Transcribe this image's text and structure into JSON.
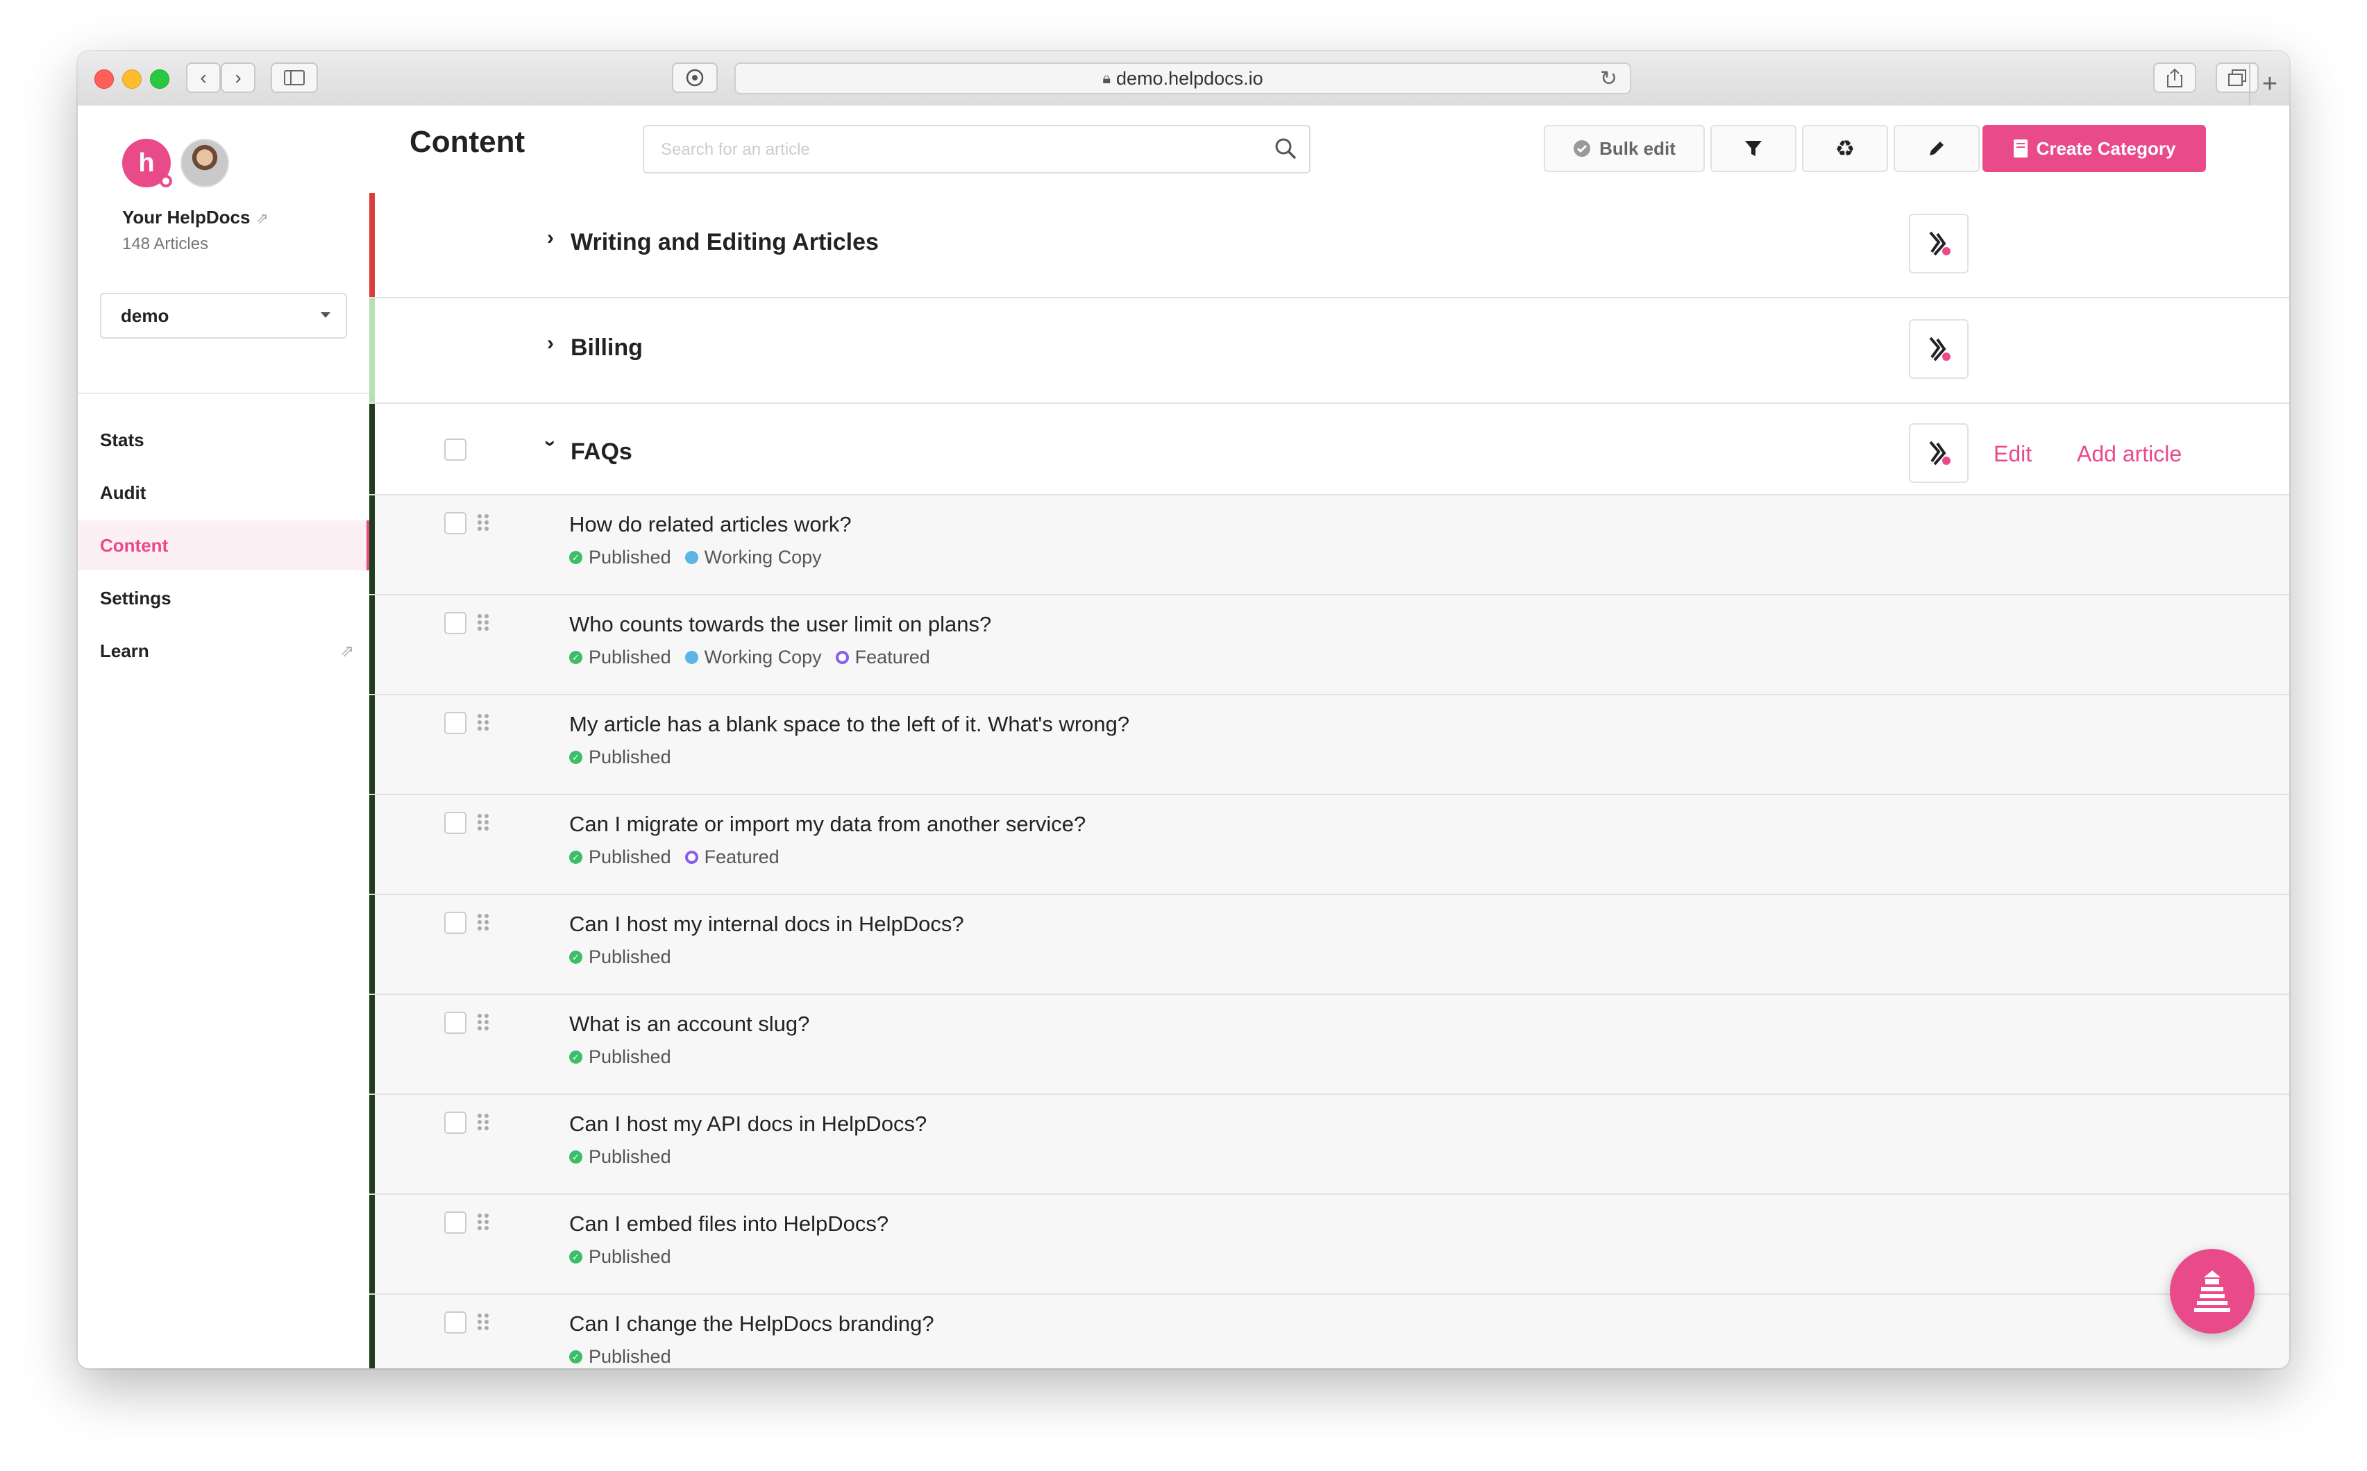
{
  "browser": {
    "url": "demo.helpdocs.io"
  },
  "sidebar": {
    "logo_letter": "h",
    "title": "Your HelpDocs",
    "subtitle": "148 Articles",
    "account_select": "demo",
    "nav": [
      {
        "label": "Stats"
      },
      {
        "label": "Audit"
      },
      {
        "label": "Content",
        "active": true
      },
      {
        "label": "Settings"
      },
      {
        "label": "Learn",
        "external": true
      }
    ]
  },
  "header": {
    "title": "Content",
    "search_placeholder": "Search for an article",
    "bulk_edit_label": "Bulk edit",
    "create_category_label": "Create Category"
  },
  "categories": [
    {
      "title": "Writing and Editing Articles",
      "expanded": false,
      "color": "#d8403c"
    },
    {
      "title": "Billing",
      "expanded": false,
      "color": "#b8e0b6"
    },
    {
      "title": "FAQs",
      "expanded": true,
      "color": "#1f3d1e",
      "edit_label": "Edit",
      "add_label": "Add article"
    }
  ],
  "articles": [
    {
      "title": "How do related articles work?",
      "badges": [
        "Published",
        "Working Copy"
      ]
    },
    {
      "title": "Who counts towards the user limit on plans?",
      "badges": [
        "Published",
        "Working Copy",
        "Featured"
      ]
    },
    {
      "title": "My article has a blank space to the left of it. What's wrong?",
      "badges": [
        "Published"
      ]
    },
    {
      "title": "Can I migrate or import my data from another service?",
      "badges": [
        "Published",
        "Featured"
      ]
    },
    {
      "title": "Can I host my internal docs in HelpDocs?",
      "badges": [
        "Published"
      ]
    },
    {
      "title": "What is an account slug?",
      "badges": [
        "Published"
      ]
    },
    {
      "title": "Can I host my API docs in HelpDocs?",
      "badges": [
        "Published"
      ]
    },
    {
      "title": "Can I embed files into HelpDocs?",
      "badges": [
        "Published"
      ]
    },
    {
      "title": "Can I change the HelpDocs branding?",
      "badges": [
        "Published"
      ]
    }
  ],
  "colors": {
    "accent": "#e94b8a",
    "published": "#3dbd6a",
    "working_copy": "#5bb5e6",
    "featured": "#8a5cf0"
  }
}
